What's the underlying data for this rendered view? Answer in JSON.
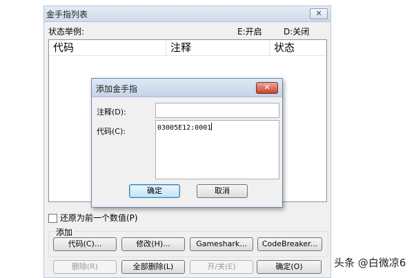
{
  "main_window": {
    "title": "金手指列表",
    "close_glyph": "✕",
    "legend_label": "状态举例:",
    "legend_on": "E:开启",
    "legend_off": "D:关闭",
    "columns": [
      "代码",
      "注释",
      "状态"
    ],
    "restore_checkbox_label": "还原为前一个数值(P)",
    "restore_checked": false,
    "add_group_title": "添加",
    "add_buttons": [
      "代码(C)...",
      "修改(H)...",
      "Gameshark...",
      "CodeBreaker..."
    ],
    "bottom_buttons": [
      {
        "label": "删除(R)",
        "enabled": false
      },
      {
        "label": "全部删除(L)",
        "enabled": true
      },
      {
        "label": "开/关(E)",
        "enabled": false
      },
      {
        "label": "确定(O)",
        "enabled": true
      }
    ]
  },
  "dialog": {
    "title": "添加金手指",
    "close_glyph": "✕",
    "comment_label": "注释(D):",
    "comment_value": "",
    "code_label": "代码(C):",
    "code_value": "03005E12:0001",
    "ok_label": "确定",
    "cancel_label": "取消"
  },
  "watermark": "头条 @白微凉6",
  "colors": {
    "dialog_close": "#c6432c",
    "title_gradient_top": "#e3ecf6"
  }
}
